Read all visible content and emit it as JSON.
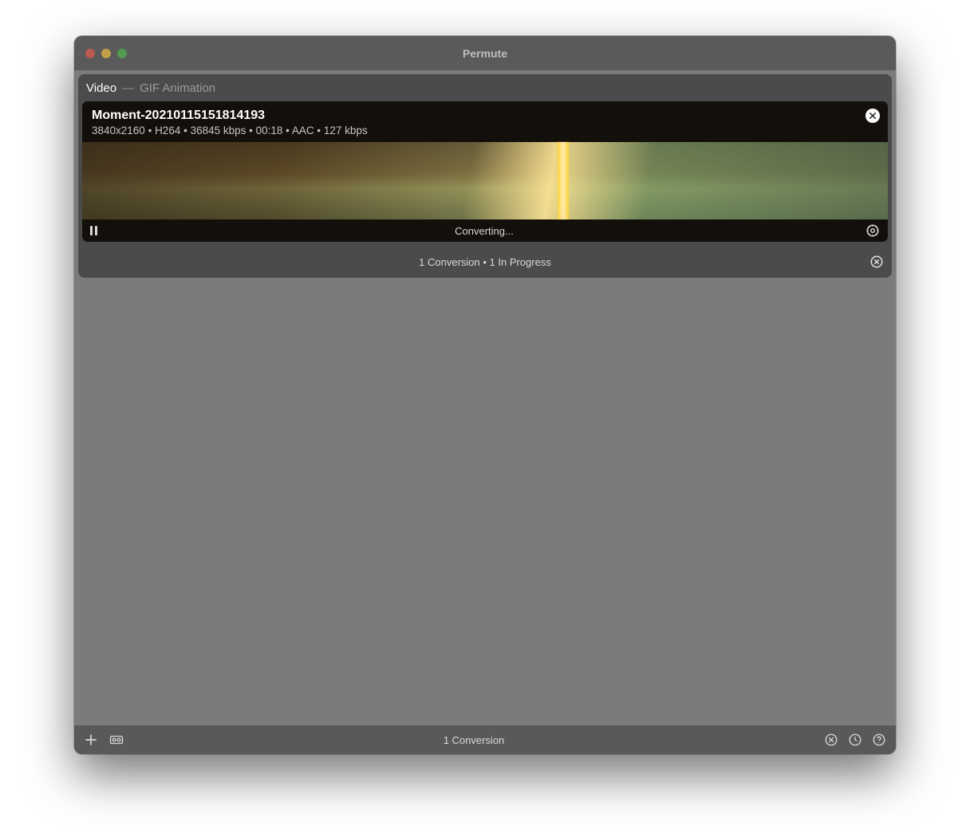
{
  "window": {
    "title": "Permute"
  },
  "group": {
    "category": "Video",
    "target_format": "GIF Animation",
    "summary": "1 Conversion • 1 In Progress"
  },
  "item": {
    "filename": "Moment-20210115151814193",
    "resolution": "3840x2160",
    "video_codec": "H264",
    "video_bitrate": "36845 kbps",
    "duration": "00:18",
    "audio_codec": "AAC",
    "audio_bitrate": "127 kbps",
    "status": "Converting..."
  },
  "toolbar": {
    "summary": "1 Conversion"
  },
  "icons": {
    "add": "plus-icon",
    "presets": "presets-icon",
    "cancel_all": "cancel-circle-icon",
    "history": "clock-icon",
    "help": "help-icon"
  }
}
